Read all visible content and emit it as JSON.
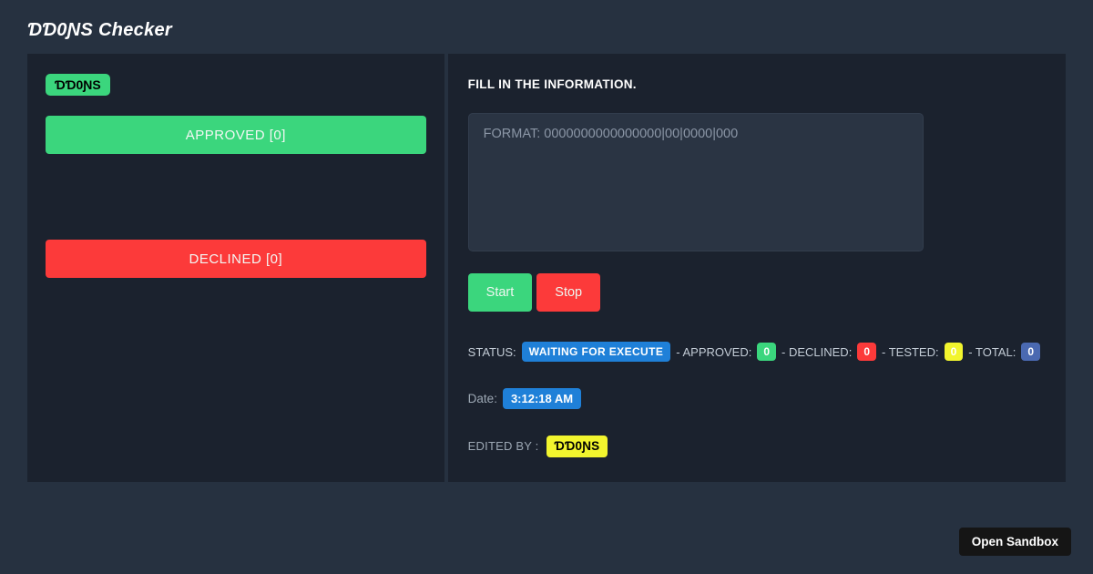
{
  "app": {
    "title": "ƊƊ0ƝS Checker"
  },
  "left_panel": {
    "brand_badge": "ƊƊ0ƝS",
    "approved_button": "APPROVED [0]",
    "declined_button": "DECLINED [0]"
  },
  "form": {
    "heading": "FILL IN THE INFORMATION.",
    "input_placeholder": "FORMAT: 0000000000000000|00|0000|000",
    "input_value": "",
    "start_button": "Start",
    "stop_button": "Stop"
  },
  "status": {
    "label": "STATUS:",
    "state": "WAITING FOR EXECUTE",
    "approved_label": "- APPROVED:",
    "approved_count": "0",
    "declined_label": "- DECLINED:",
    "declined_count": "0",
    "tested_label": "- TESTED:",
    "tested_count": "0",
    "total_label": "- TOTAL:",
    "total_count": "0"
  },
  "date": {
    "label": "Date:",
    "value": "3:12:18 AM"
  },
  "edited_by": {
    "label": "EDITED BY :",
    "value": "ƊƊ0ƝS"
  },
  "footer": {
    "open_sandbox_button": "Open Sandbox"
  },
  "colors": {
    "green": "#3bd67d",
    "red": "#fc3a3a",
    "blue": "#1f80d8",
    "yellow": "#f2f52e",
    "indigo": "#4a69b1",
    "background": "#263140",
    "panel": "#1b222e",
    "input_background": "#2a3443"
  }
}
